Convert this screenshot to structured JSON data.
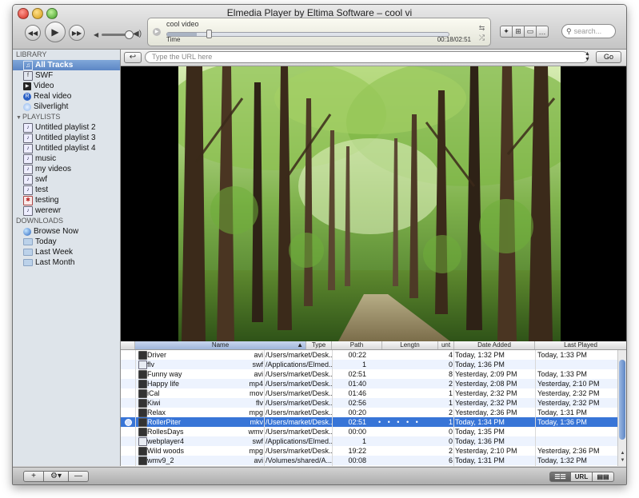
{
  "window": {
    "title": "Elmedia Player by Eltima Software – cool vi"
  },
  "toolbar": {
    "rewind_icon": "rewind-icon",
    "play_icon": "play-icon",
    "forward_icon": "fast-forward-icon",
    "now_playing": "cool video",
    "time_label": "Time",
    "time_counter": "00:18/02:51",
    "progress_fraction": 0.105,
    "search_placeholder": "search..."
  },
  "sidebar": {
    "library_header": "LIBRARY",
    "library": [
      {
        "label": "All Tracks",
        "icon": "all-tracks-icon",
        "selected": true
      },
      {
        "label": "SWF",
        "icon": "swf-icon"
      },
      {
        "label": "Video",
        "icon": "video-icon"
      },
      {
        "label": "Real video",
        "icon": "real-video-icon"
      },
      {
        "label": "Silverlight",
        "icon": "silverlight-icon"
      }
    ],
    "playlists_header": "PLAYLISTS",
    "playlists": [
      {
        "label": "Untitled playlist 2",
        "icon": "playlist-icon"
      },
      {
        "label": "Untitled playlist 3",
        "icon": "playlist-icon"
      },
      {
        "label": "Untitled playlist 4",
        "icon": "playlist-icon"
      },
      {
        "label": "music",
        "icon": "playlist-icon"
      },
      {
        "label": "my videos",
        "icon": "playlist-icon"
      },
      {
        "label": "swf",
        "icon": "playlist-icon"
      },
      {
        "label": "test",
        "icon": "playlist-icon"
      },
      {
        "label": "testing",
        "icon": "smart-playlist-icon"
      },
      {
        "label": "werewr",
        "icon": "playlist-icon"
      }
    ],
    "downloads_header": "DOWNLOADS",
    "downloads": [
      {
        "label": "Browse Now",
        "icon": "globe-icon"
      },
      {
        "label": "Today",
        "icon": "folder-icon"
      },
      {
        "label": "Last Week",
        "icon": "folder-icon"
      },
      {
        "label": "Last Month",
        "icon": "folder-icon"
      }
    ]
  },
  "url_bar": {
    "placeholder": "Type the URL here",
    "go_label": "Go"
  },
  "table": {
    "columns": {
      "name": "Name",
      "type": "Type",
      "path": "Path",
      "length": "Lengtn",
      "count": "unt",
      "date_added": "Date Added",
      "last_played": "Last Played"
    },
    "rows": [
      {
        "name": "Driver",
        "type": "avi",
        "path": "/Users/market/Desk...",
        "length": "00:22",
        "dots": "",
        "count": "4",
        "date_added": "Today, 1:32 PM",
        "last_played": "Today, 1:33 PM",
        "kind": "video"
      },
      {
        "name": "flv",
        "type": "swf",
        "path": "/Applications/Elmed...",
        "length": "1",
        "dots": "",
        "count": "0",
        "date_added": "Today, 1:36 PM",
        "last_played": "",
        "kind": "swf"
      },
      {
        "name": "Funny way",
        "type": "avi",
        "path": "/Users/market/Desk...",
        "length": "02:51",
        "dots": "",
        "count": "8",
        "date_added": "Yesterday, 2:09 PM",
        "last_played": "Today, 1:33 PM",
        "kind": "video"
      },
      {
        "name": "Happy life",
        "type": "mp4",
        "path": "/Users/market/Desk...",
        "length": "01:40",
        "dots": "",
        "count": "2",
        "date_added": "Yesterday, 2:08 PM",
        "last_played": "Yesterday, 2:10 PM",
        "kind": "video"
      },
      {
        "name": "iCal",
        "type": "mov",
        "path": "/Users/market/Desk...",
        "length": "01:46",
        "dots": "",
        "count": "1",
        "date_added": "Yesterday, 2:32 PM",
        "last_played": "Yesterday, 2:32 PM",
        "kind": "video"
      },
      {
        "name": "Kiwi",
        "type": "flv",
        "path": "/Users/market/Desk...",
        "length": "02:56",
        "dots": "",
        "count": "1",
        "date_added": "Yesterday, 2:32 PM",
        "last_played": "Yesterday, 2:32 PM",
        "kind": "video"
      },
      {
        "name": "Relax",
        "type": "mpg",
        "path": "/Users/market/Desk...",
        "length": "00:20",
        "dots": "",
        "count": "2",
        "date_added": "Yesterday, 2:36 PM",
        "last_played": "Today, 1:31 PM",
        "kind": "video"
      },
      {
        "name": "RollerPiter",
        "type": "mkv",
        "path": "/Users/market/Desk...",
        "length": "02:51",
        "dots": "• • • • •",
        "count": "1",
        "date_added": "Today, 1:34 PM",
        "last_played": "Today, 1:36 PM",
        "kind": "video",
        "selected": true
      },
      {
        "name": "RollesDays",
        "type": "wmv",
        "path": "/Users/market/Desk...",
        "length": "00:00",
        "dots": "",
        "count": "0",
        "date_added": "Today, 1:35 PM",
        "last_played": "",
        "kind": "video"
      },
      {
        "name": "webplayer4",
        "type": "swf",
        "path": "/Applications/Elmed...",
        "length": "1",
        "dots": "",
        "count": "0",
        "date_added": "Today, 1:36 PM",
        "last_played": "",
        "kind": "swf"
      },
      {
        "name": "Wild woods",
        "type": "mpg",
        "path": "/Users/market/Desk...",
        "length": "19:22",
        "dots": "",
        "count": "2",
        "date_added": "Yesterday, 2:10 PM",
        "last_played": "Yesterday, 2:36 PM",
        "kind": "video"
      },
      {
        "name": "wmv9_2",
        "type": "avi",
        "path": "/Volumes/shared/A...",
        "length": "00:08",
        "dots": "",
        "count": "6",
        "date_added": "Today, 1:31 PM",
        "last_played": "Today, 1:32 PM",
        "kind": "video"
      }
    ]
  },
  "bottom_bar": {
    "add_label": "+",
    "gear_label": "⚙▾",
    "remove_label": "—",
    "url_view_label": "URL"
  }
}
